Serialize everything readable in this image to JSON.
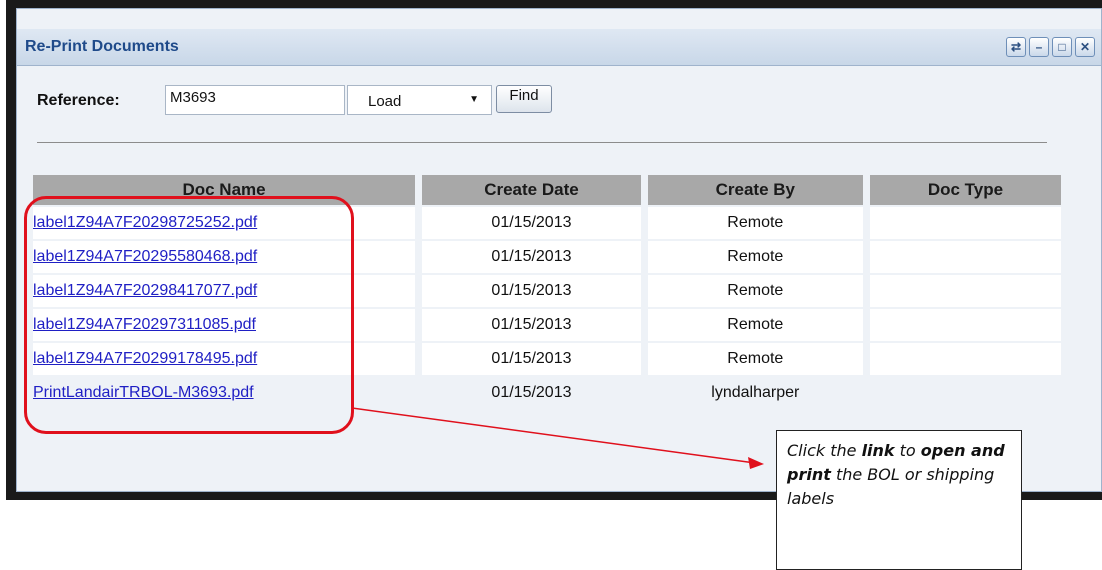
{
  "window": {
    "title": "Re-Print Documents",
    "buttons": [
      "refresh-icon",
      "minimize-icon",
      "maximize-icon",
      "close-icon"
    ]
  },
  "toolbar": {
    "reference_label": "Reference:",
    "reference_value": "M3693",
    "type_select": "Load",
    "find_label": "Find"
  },
  "table": {
    "headers": [
      "Doc Name",
      "Create Date",
      "Create By",
      "Doc Type"
    ],
    "rows": [
      {
        "name": "label1Z94A7F20298725252.pdf",
        "date": "01/15/2013",
        "by": "Remote",
        "type": ""
      },
      {
        "name": "label1Z94A7F20295580468.pdf",
        "date": "01/15/2013",
        "by": "Remote",
        "type": ""
      },
      {
        "name": "label1Z94A7F20298417077.pdf",
        "date": "01/15/2013",
        "by": "Remote",
        "type": ""
      },
      {
        "name": "label1Z94A7F20297311085.pdf",
        "date": "01/15/2013",
        "by": "Remote",
        "type": ""
      },
      {
        "name": "label1Z94A7F20299178495.pdf",
        "date": "01/15/2013",
        "by": "Remote",
        "type": ""
      },
      {
        "name": "PrintLandairTRBOL-M3693.pdf",
        "date": "01/15/2013",
        "by": "lyndalharper",
        "type": ""
      }
    ]
  },
  "callout": {
    "p1": "Click the ",
    "b1": "link",
    "p2": " to ",
    "b2": "open and print",
    "p3": " the BOL or shipping labels"
  },
  "colors": {
    "title": "#1f4a8a",
    "link": "#1f1fc4",
    "highlight": "#e0101c",
    "header_bg": "#a8a8a8"
  }
}
